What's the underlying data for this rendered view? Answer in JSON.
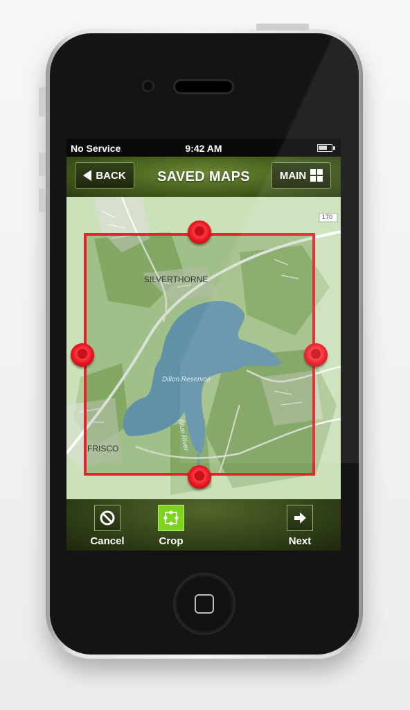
{
  "status_bar": {
    "carrier": "No Service",
    "time": "9:42 AM",
    "battery_icon": "battery-icon"
  },
  "nav": {
    "back_label": "BACK",
    "title": "SAVED MAPS",
    "main_label": "MAIN"
  },
  "map": {
    "labels": {
      "highway": "170",
      "town_north": "SILVERTHORNE",
      "reservoir": "Dillon Reservoir",
      "river": "Blue River",
      "town_south": "FRISCO"
    },
    "crop_color": "#e8232b",
    "water_color": "#6a9ec6"
  },
  "toolbar": {
    "cancel_label": "Cancel",
    "crop_label": "Crop",
    "next_label": "Next",
    "crop_active_color": "#7ed321"
  }
}
